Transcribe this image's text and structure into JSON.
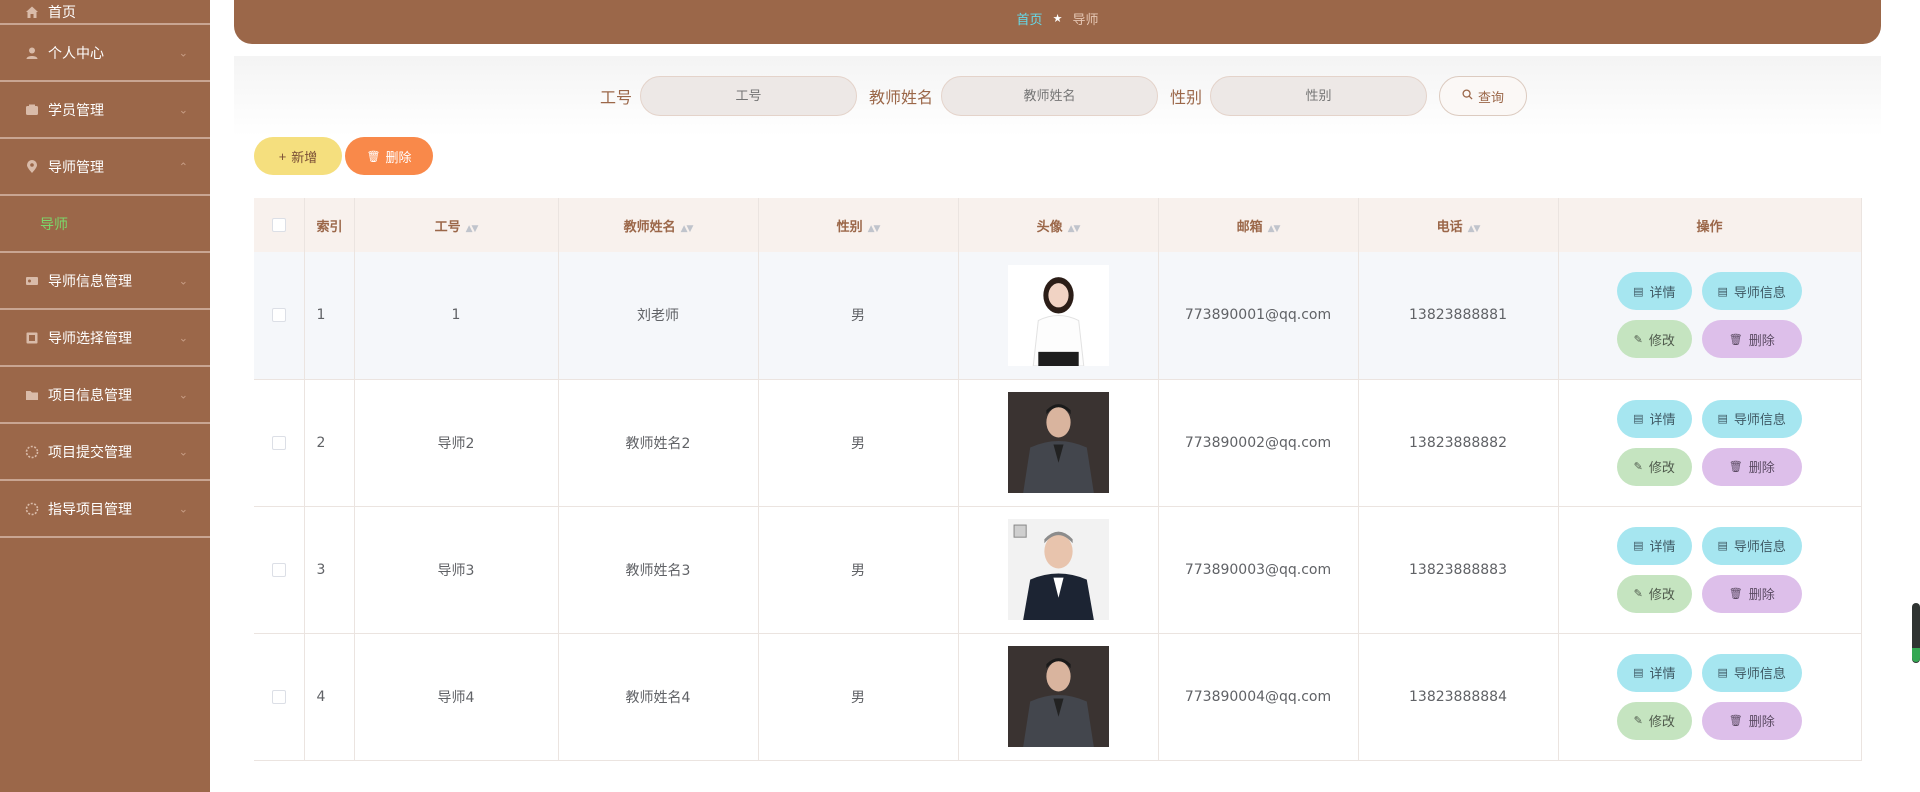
{
  "sidebar": {
    "items": [
      {
        "label": "首页",
        "icon": "home-icon"
      },
      {
        "label": "个人中心",
        "icon": "user-icon"
      },
      {
        "label": "学员管理",
        "icon": "students-icon"
      },
      {
        "label": "导师管理",
        "icon": "location-icon",
        "expanded": true
      },
      {
        "label": "导师信息管理",
        "icon": "id-card-icon"
      },
      {
        "label": "导师选择管理",
        "icon": "grid-icon"
      },
      {
        "label": "项目信息管理",
        "icon": "folder-icon"
      },
      {
        "label": "项目提交管理",
        "icon": "spinner-icon"
      },
      {
        "label": "指导项目管理",
        "icon": "spinner-icon"
      }
    ],
    "submenu_active": "导师"
  },
  "breadcrumb": {
    "home": "首页",
    "current": "导师"
  },
  "search": {
    "fields": [
      {
        "label": "工号",
        "placeholder": "工号"
      },
      {
        "label": "教师姓名",
        "placeholder": "教师姓名"
      },
      {
        "label": "性别",
        "placeholder": "性别"
      }
    ],
    "button": "查询"
  },
  "toolbar": {
    "add_label": "新增",
    "delete_label": "删除"
  },
  "table": {
    "columns": [
      "索引",
      "工号",
      "教师姓名",
      "性别",
      "头像",
      "邮箱",
      "电话",
      "操作"
    ],
    "rows": [
      {
        "index": "1",
        "id": "1",
        "name": "刘老师",
        "gender": "男",
        "email": "773890001@qq.com",
        "phone": "13823888881",
        "avatar": "female-avatar"
      },
      {
        "index": "2",
        "id": "导师2",
        "name": "教师姓名2",
        "gender": "男",
        "email": "773890002@qq.com",
        "phone": "13823888882",
        "avatar": "male-avatar-dark"
      },
      {
        "index": "3",
        "id": "导师3",
        "name": "教师姓名3",
        "gender": "男",
        "email": "773890003@qq.com",
        "phone": "13823888883",
        "avatar": "male-avatar-light"
      },
      {
        "index": "4",
        "id": "导师4",
        "name": "教师姓名4",
        "gender": "男",
        "email": "773890004@qq.com",
        "phone": "13823888884",
        "avatar": "male-avatar-dark"
      }
    ],
    "row_actions": {
      "detail": "详情",
      "info": "导师信息",
      "edit": "修改",
      "delete": "删除"
    }
  },
  "colors": {
    "sidebar": "#9b6749",
    "accent_green": "#7bd96a",
    "crumb_link": "#66d9e8",
    "add": "#f5df7e",
    "delete": "#f9894a"
  }
}
